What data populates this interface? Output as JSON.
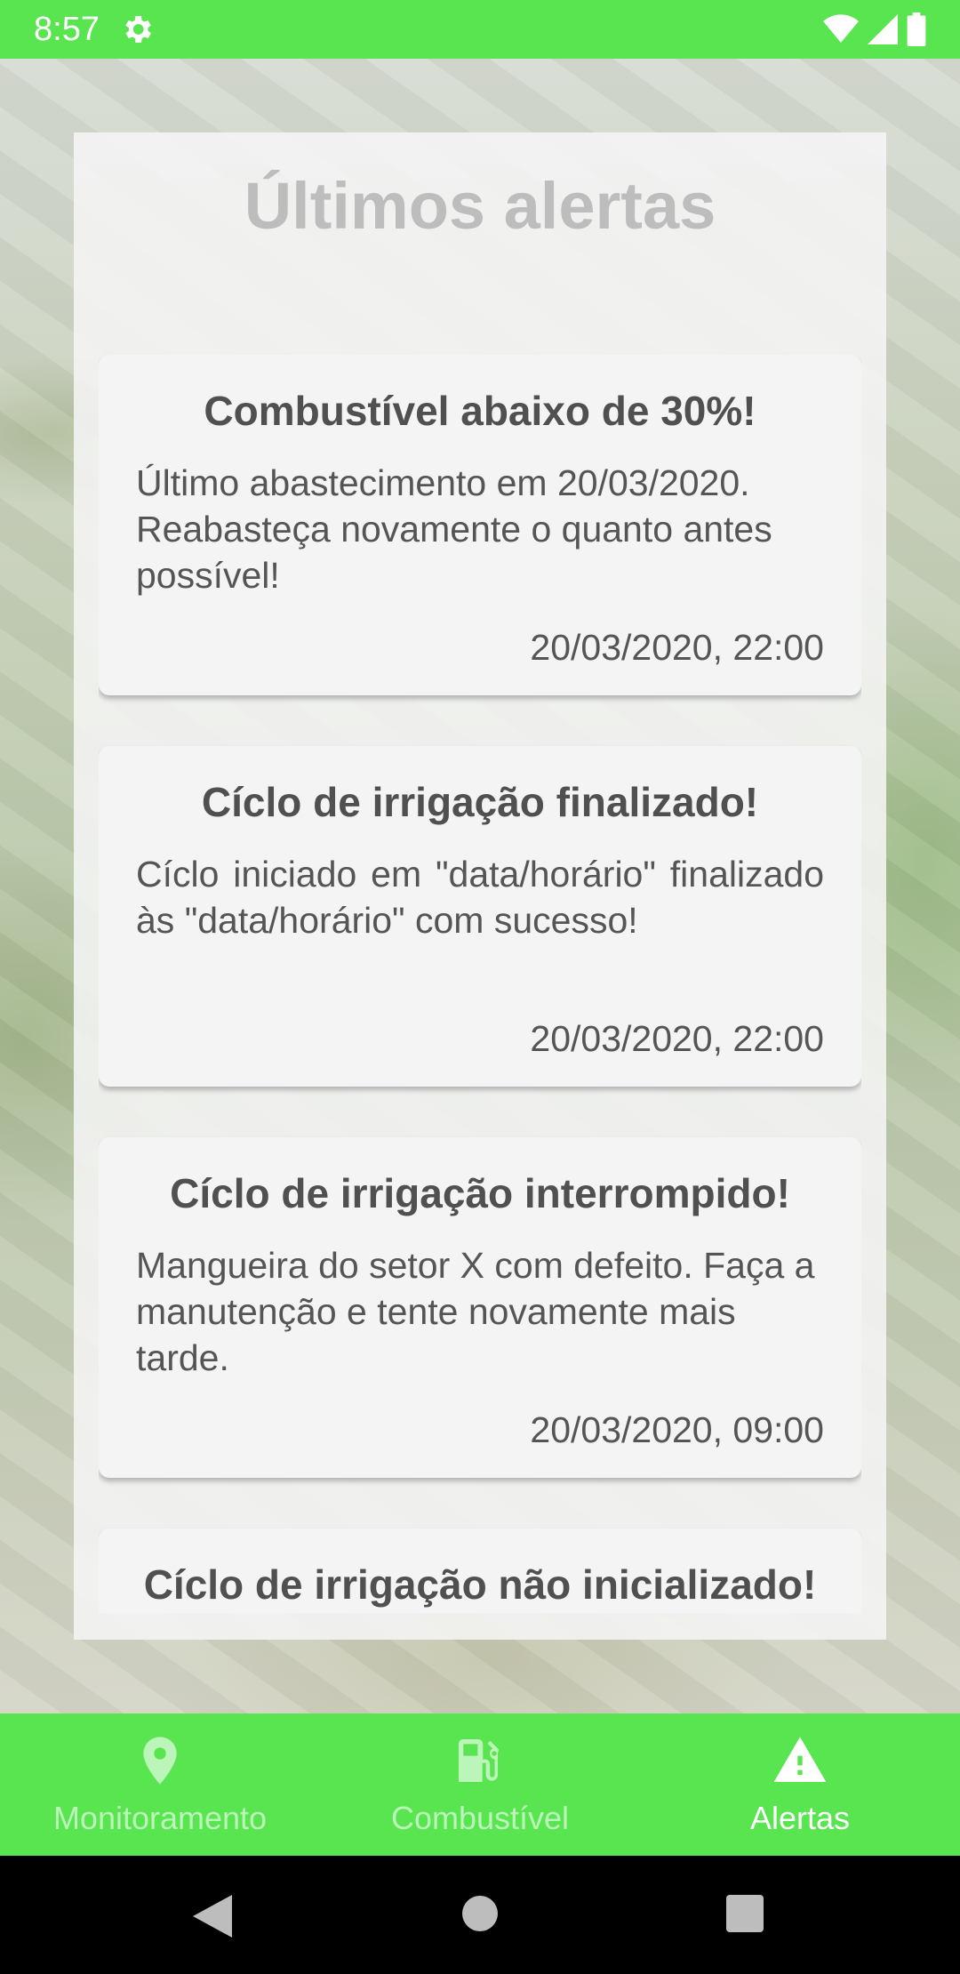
{
  "status_bar": {
    "time": "8:57",
    "icons": [
      "gear-icon",
      "wifi-icon",
      "signal-icon",
      "battery-icon"
    ]
  },
  "panel": {
    "title": "Últimos alertas"
  },
  "alerts": [
    {
      "title": "Combustível abaixo de 30%!",
      "body": "Último abastecimento em 20/03/2020. Reabasteça novamente o quanto antes possível!",
      "time": "20/03/2020, 22:00"
    },
    {
      "title": "Cíclo de irrigação finalizado!",
      "body": "Cíclo iniciado em \"data/horário\" finalizado às \"data/horário\" com sucesso!",
      "time": "20/03/2020, 22:00"
    },
    {
      "title": "Cíclo de irrigação interrompido!",
      "body": "Mangueira do setor X com defeito. Faça a manutenção e tente novamente mais tarde.",
      "time": "20/03/2020, 09:00"
    },
    {
      "title": "Cíclo de irrigação não inicializado!"
    }
  ],
  "bottom_nav": {
    "items": [
      {
        "label": "Monitoramento",
        "icon": "location-pin-icon",
        "active": false
      },
      {
        "label": "Combustível",
        "icon": "fuel-pump-icon",
        "active": false
      },
      {
        "label": "Alertas",
        "icon": "warning-icon",
        "active": true
      }
    ]
  },
  "system_nav": {
    "icons": [
      "back-icon",
      "home-icon",
      "recents-icon"
    ]
  },
  "colors": {
    "accent": "#58e550",
    "title_gray": "#bdbdbd",
    "card_bg": "#f4f4f4"
  }
}
